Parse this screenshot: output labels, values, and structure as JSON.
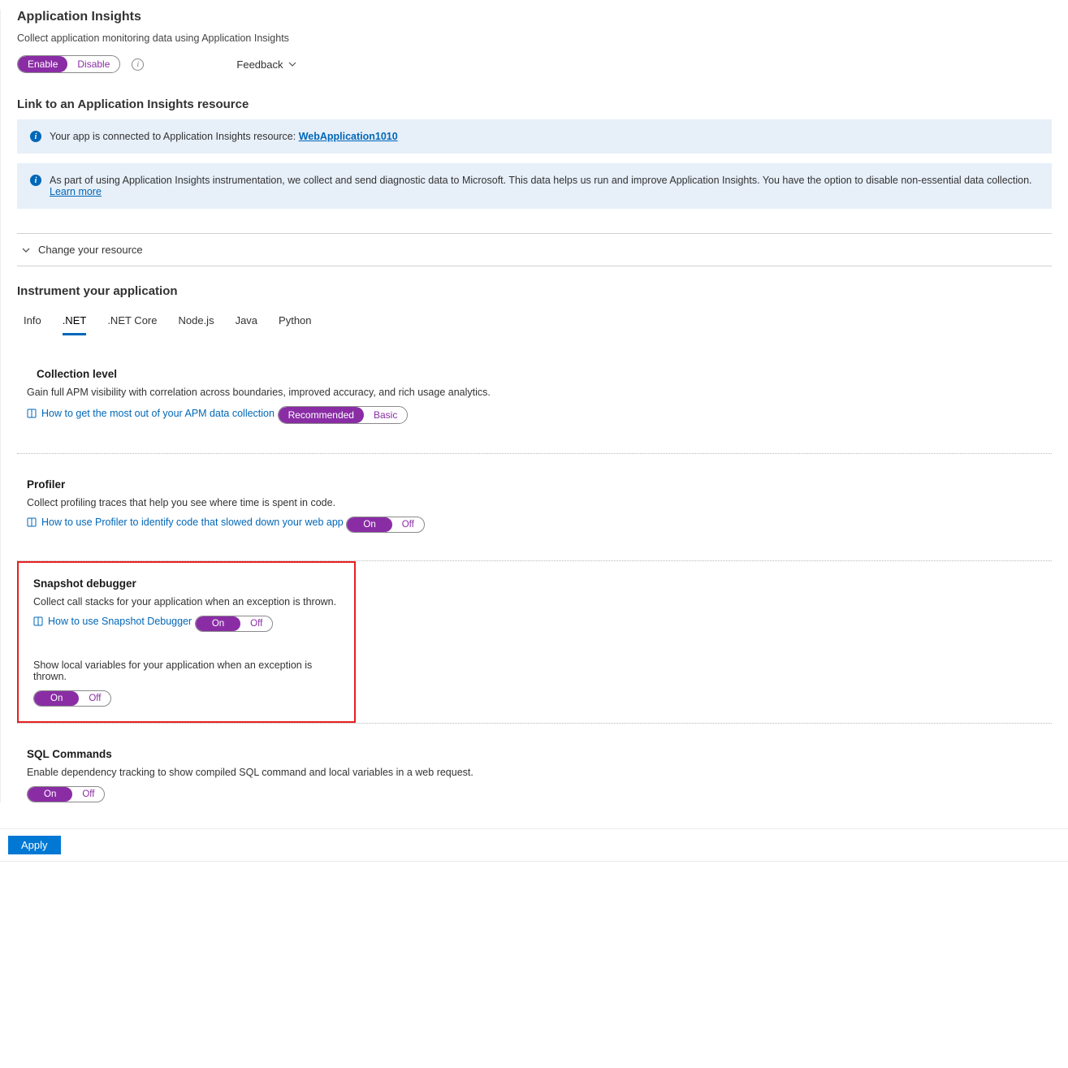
{
  "header": {
    "title": "Application Insights",
    "subtitle": "Collect application monitoring data using Application Insights",
    "toggle": {
      "on": "Enable",
      "off": "Disable",
      "active": "on"
    },
    "info_tooltip": "i",
    "feedback": "Feedback"
  },
  "link_resource": {
    "heading": "Link to an Application Insights resource",
    "banner1_prefix": "Your app is connected to Application Insights resource: ",
    "banner1_link": "WebApplication1010",
    "banner2_text": "As part of using Application Insights instrumentation, we collect and send diagnostic data to Microsoft. This data helps us run and improve Application Insights. You have the option to disable non-essential data collection. ",
    "banner2_link": "Learn more",
    "expander": "Change your resource"
  },
  "instrument": {
    "heading": "Instrument your application",
    "tabs": [
      "Info",
      ".NET",
      ".NET Core",
      "Node.js",
      "Java",
      "Python"
    ],
    "active_tab": ".NET"
  },
  "collection": {
    "heading": "Collection level",
    "desc": "Gain full APM visibility with correlation across boundaries, improved accuracy, and rich usage analytics.",
    "help": "How to get the most out of your APM data collection",
    "toggle": {
      "on": "Recommended",
      "off": "Basic",
      "active": "on"
    }
  },
  "profiler": {
    "heading": "Profiler",
    "desc": "Collect profiling traces that help you see where time is spent in code.",
    "help": "How to use Profiler to identify code that slowed down your web app",
    "toggle": {
      "on": "On",
      "off": "Off",
      "active": "on"
    }
  },
  "snapshot": {
    "heading": "Snapshot debugger",
    "desc": "Collect call stacks for your application when an exception is thrown.",
    "help": "How to use Snapshot Debugger",
    "toggle1": {
      "on": "On",
      "off": "Off",
      "active": "on"
    },
    "desc2": "Show local variables for your application when an exception is thrown.",
    "toggle2": {
      "on": "On",
      "off": "Off",
      "active": "on"
    }
  },
  "sql": {
    "heading": "SQL Commands",
    "desc": "Enable dependency tracking to show compiled SQL command and local variables in a web request.",
    "toggle": {
      "on": "On",
      "off": "Off",
      "active": "on"
    }
  },
  "footer": {
    "apply": "Apply"
  }
}
